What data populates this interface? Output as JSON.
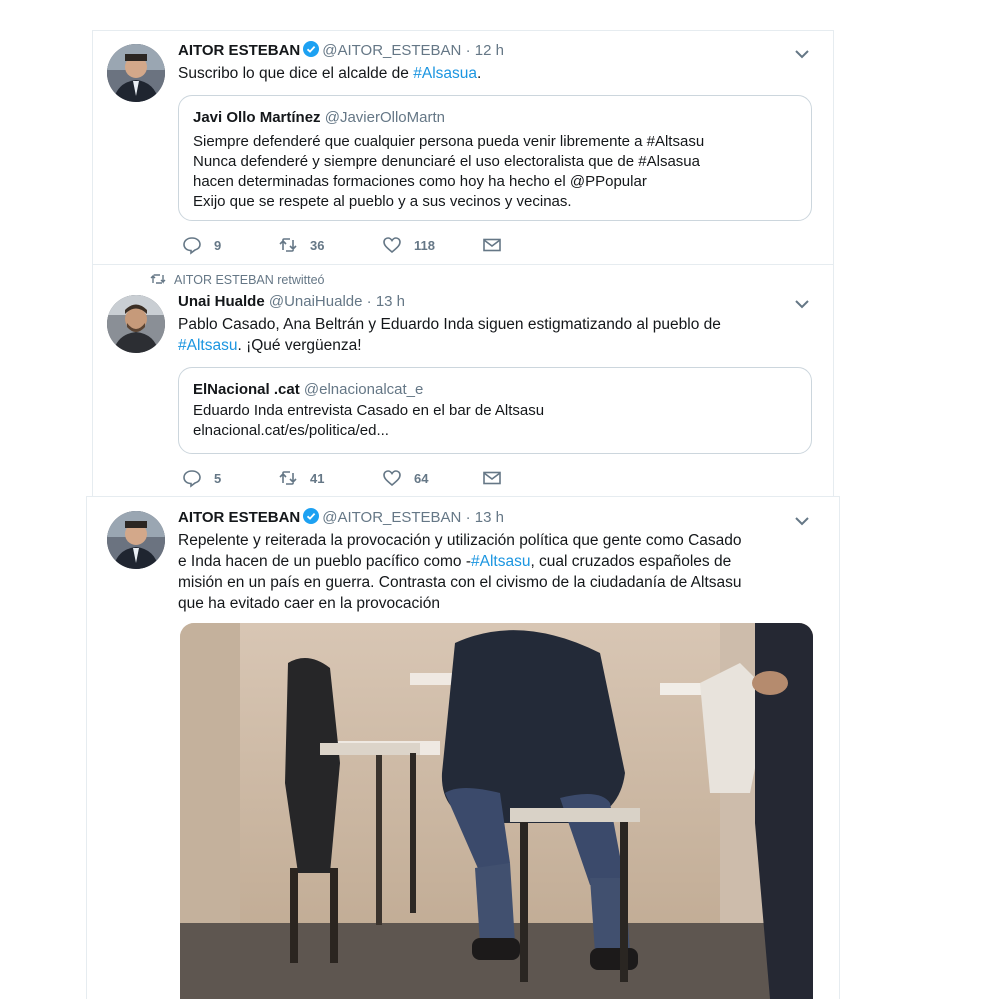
{
  "tweets": [
    {
      "author_name": "AITOR ESTEBAN",
      "handle": "@AITOR_ESTEBAN",
      "dot": "·",
      "time": "12 h",
      "text_before": "Suscribo lo que dice el alcalde de ",
      "hashtag": "#Alsasua",
      "text_after": ".",
      "quote": {
        "name": "Javi Ollo Martínez",
        "handle": "@JavierOlloMartn",
        "lines": [
          "Siempre defenderé que cualquier persona pueda venir libremente a #Altsasu",
          "Nunca defenderé y siempre denunciaré el uso electoralista que de #Alsasua",
          "hacen determinadas formaciones como hoy ha hecho el @PPopular",
          "Exijo que se respete al pueblo y a sus vecinos y vecinas."
        ]
      },
      "actions": {
        "replies": "9",
        "retweets": "36",
        "likes": "118"
      }
    },
    {
      "retweet_label": "AITOR ESTEBAN retwitteó",
      "author_name": "Unai Hualde",
      "handle": "@UnaiHualde",
      "dot": "·",
      "time": "13 h",
      "text_line1": "Pablo Casado, Ana Beltrán y Eduardo Inda siguen estigmatizando al pueblo de",
      "hashtag": "#Altsasu",
      "text_after": ". ¡Qué vergüenza!",
      "quote": {
        "name": "ElNacional .cat",
        "handle": "@elnacionalcat_e",
        "lines": [
          "Eduardo Inda entrevista Casado en el bar de Altsasu",
          "elnacional.cat/es/politica/ed..."
        ]
      },
      "actions": {
        "replies": "5",
        "retweets": "41",
        "likes": "64"
      }
    },
    {
      "author_name": "AITOR ESTEBAN",
      "handle": "@AITOR_ESTEBAN",
      "dot": "·",
      "time": "13 h",
      "line1": "Repelente y reiterada la provocación y utilización política que gente como Casado",
      "line2_before": "e Inda hacen de un pueblo pacífico como -",
      "hashtag": "#Altsasu",
      "line2_after": ", cual cruzados españoles de",
      "line3": "misión en un país en guerra. Contrasta con el civismo de la ciudadanía de Altsasu",
      "line4": "que ha evitado caer en la provocación"
    }
  ],
  "colors": {
    "link": "#1b95e0",
    "muted": "#657786",
    "verified": "#1da1f2",
    "border": "#e6ecf0"
  },
  "icons": [
    "verified-badge-icon",
    "chevron-down-icon",
    "reply-icon",
    "retweet-icon",
    "like-icon",
    "message-icon"
  ]
}
